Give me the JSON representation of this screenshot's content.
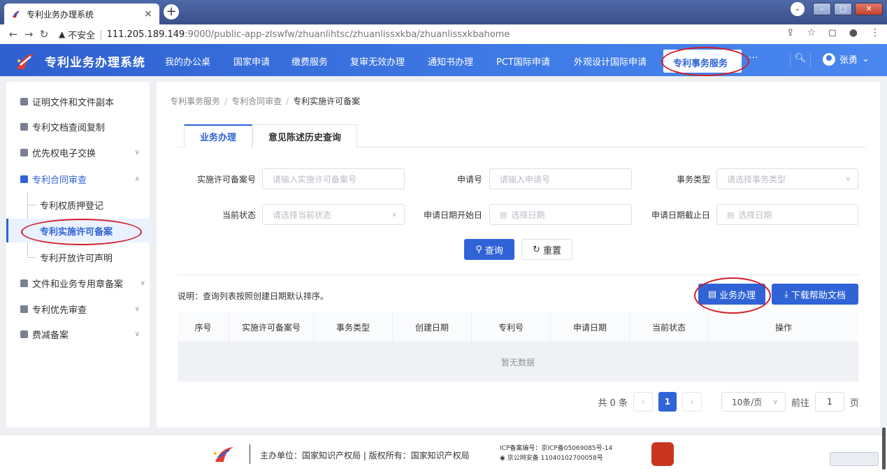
{
  "browser": {
    "tab_title": "专利业务办理系统",
    "tab_close": "×",
    "new_tab": "+",
    "insecure_label": "不安全",
    "url_host": "111.205.189.149",
    "url_path": ":9000/public-app-zlswfw/zhuanlihtsc/zhuanlissxkba/zhuanlissxkbahome"
  },
  "app": {
    "title": "专利业务办理系统",
    "nav": [
      "我的办公桌",
      "国家申请",
      "缴费服务",
      "复审无效办理",
      "通知书办理",
      "PCT国际申请",
      "外观设计国际申请"
    ],
    "nav_active": "专利事务服务",
    "nav_more": "···",
    "user": "张勇"
  },
  "sidebar": {
    "items": [
      {
        "label": "证明文件和文件副本"
      },
      {
        "label": "专利文档查阅复制"
      },
      {
        "label": "优先权电子交换"
      },
      {
        "label": "专利合同审查"
      },
      {
        "label": "文件和业务专用章备案"
      },
      {
        "label": "专利优先审查"
      },
      {
        "label": "费减备案"
      }
    ],
    "sub_items": [
      {
        "label": "专利权质押登记"
      },
      {
        "label": "专利实施许可备案"
      },
      {
        "label": "专利开放许可声明"
      }
    ]
  },
  "breadcrumb": [
    "专利事务服务",
    "专利合同审查",
    "专利实施许可备案"
  ],
  "tabs": [
    "业务办理",
    "意见陈述历史查询"
  ],
  "form": {
    "license_no_label": "实施许可备案号",
    "license_no_placeholder": "请输入实施许可备案号",
    "app_no_label": "申请号",
    "app_no_placeholder": "请输入申请号",
    "type_label": "事务类型",
    "type_placeholder": "请选择事务类型",
    "status_label": "当前状态",
    "status_placeholder": "请选择当前状态",
    "start_label": "申请日期开始日",
    "start_placeholder": "选择日期",
    "end_label": "申请日期截止日",
    "end_placeholder": "选择日期",
    "query": "查询",
    "reset": "重置"
  },
  "note": "说明：查询列表按照创建日期默认排序。",
  "actions": {
    "handle": "业务办理",
    "help": "下载帮助文档"
  },
  "table": {
    "columns": [
      "序号",
      "实施许可备案号",
      "事务类型",
      "创建日期",
      "专利号",
      "申请日期",
      "当前状态",
      "操作"
    ],
    "empty": "暂无数据"
  },
  "pager": {
    "total": "共 0 条",
    "page": "1",
    "page_size": "10条/页",
    "goto_label": "前往",
    "goto_value": "1",
    "page_unit": "页"
  },
  "footer": {
    "host": "主办单位：国家知识产权局 | 版权所有：国家知识产权局",
    "icp": "ICP备案编号：京ICP备05069085号-14",
    "police": "京公网安备 11040102700058号"
  },
  "colors": {
    "accent": "#2f63d6",
    "annotation": "#d0202a"
  }
}
